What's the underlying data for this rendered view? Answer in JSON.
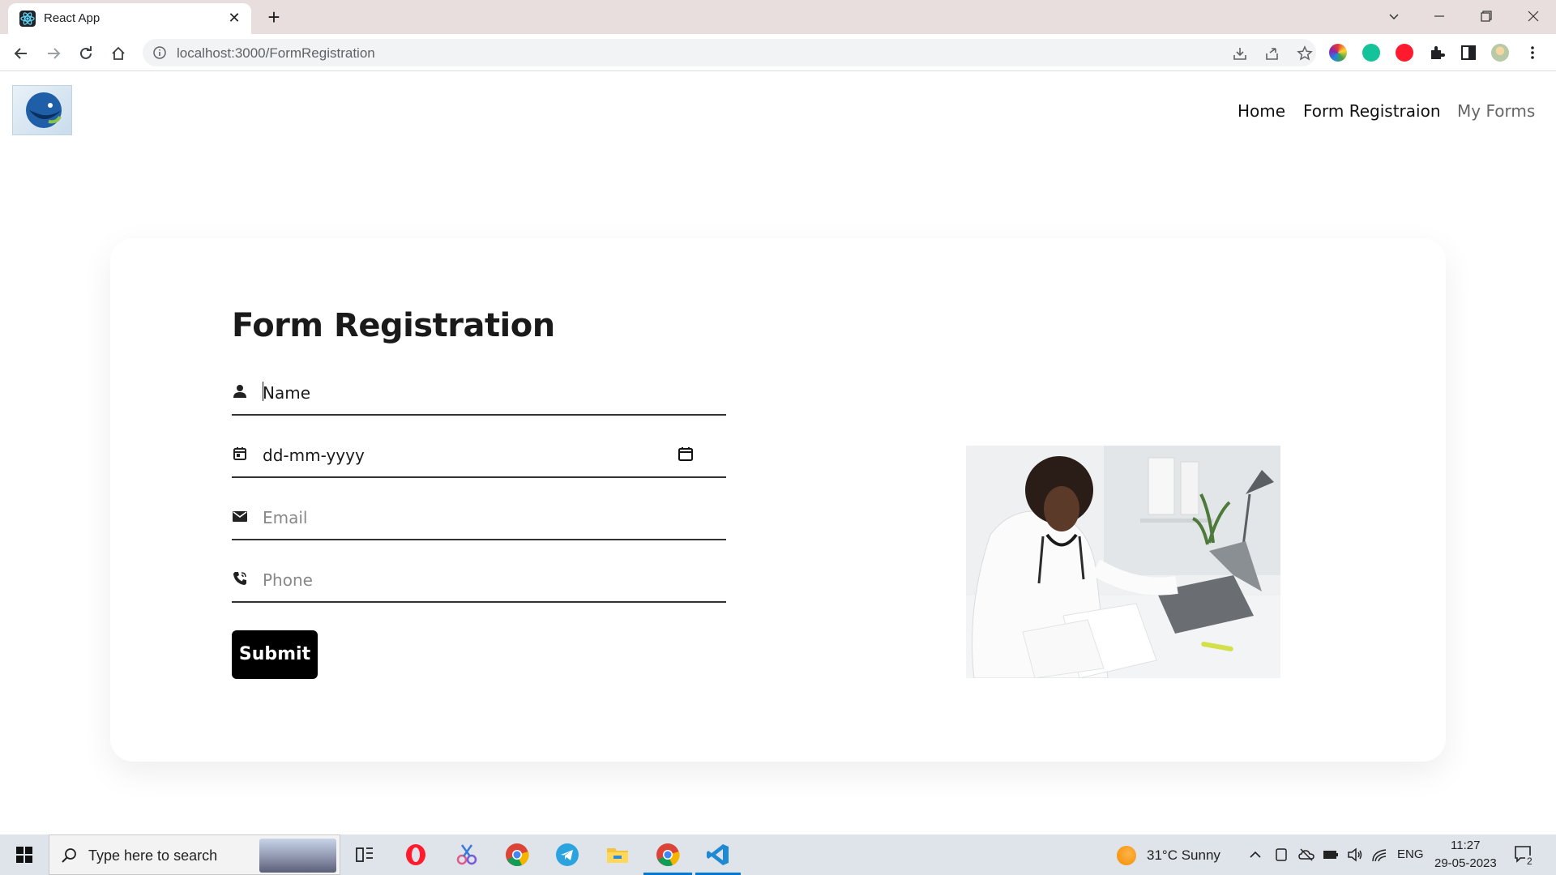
{
  "browser": {
    "tab_title": "React App",
    "tab_close": "✕",
    "new_tab": "+",
    "url": "localhost:3000/FormRegistration"
  },
  "site": {
    "nav": {
      "home": "Home",
      "form_registration": "Form Registraion",
      "my_forms": "My Forms"
    }
  },
  "form": {
    "title": "Form Registration",
    "name_placeholder": "Name",
    "dob_value": "dd-mm-yyyy",
    "email_placeholder": "Email",
    "phone_placeholder": "Phone",
    "submit_label": "Submit"
  },
  "taskbar": {
    "search_placeholder": "Type here to search",
    "weather": "31°C  Sunny",
    "language": "ENG",
    "time": "11:27",
    "date": "29-05-2023",
    "notifications": "2"
  },
  "icons": [
    "react-icon",
    "back-icon",
    "forward-icon",
    "reload-icon",
    "home-icon",
    "info-icon",
    "install-icon",
    "share-icon",
    "star-icon",
    "puzzle-icon",
    "sidepanel-icon",
    "menu-icon",
    "person-icon",
    "calendar-icon",
    "mail-icon",
    "phone-icon",
    "windows-icon",
    "search-icon"
  ],
  "colors": {
    "accent": "#000000",
    "taskbar_active": "#0078d4"
  }
}
